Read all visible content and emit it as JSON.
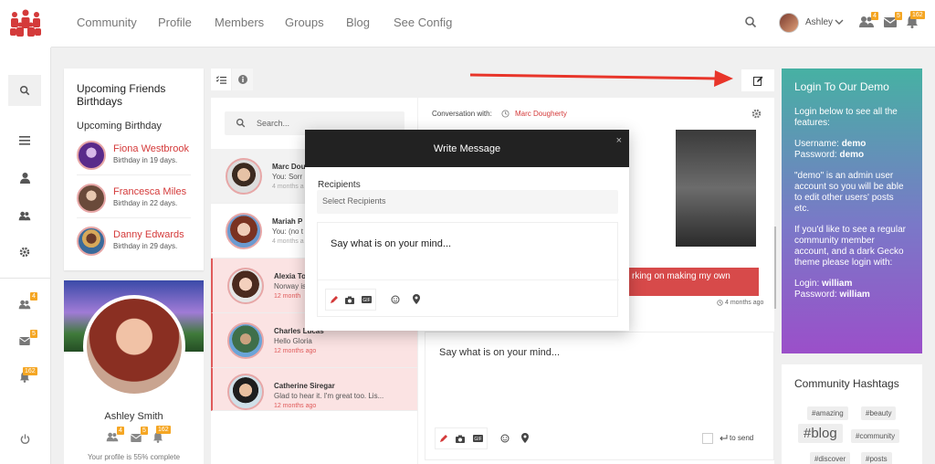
{
  "nav": {
    "links": [
      "Community",
      "Profile",
      "Members",
      "Groups",
      "Blog",
      "See Config"
    ],
    "user_name": "Ashley",
    "badges": {
      "friends": "4",
      "messages": "5",
      "notifications": "162"
    }
  },
  "rail": {
    "badges": {
      "friends": "4",
      "messages": "5",
      "notifications": "162"
    }
  },
  "birthdays": {
    "title": "Upcoming Friends Birthdays",
    "subtitle": "Upcoming Birthday",
    "items": [
      {
        "name": "Fiona Westbrook",
        "sub": "Birthday in 19 days."
      },
      {
        "name": "Francesca Miles",
        "sub": "Birthday in 22 days."
      },
      {
        "name": "Danny Edwards",
        "sub": "Birthday in 29 days."
      }
    ]
  },
  "profile": {
    "name": "Ashley Smith",
    "badges": {
      "friends": "4",
      "messages": "5",
      "notifications": "162"
    },
    "completion": "Your profile is 55% complete"
  },
  "list": {
    "search_placeholder": "Search...",
    "conversations": [
      {
        "name": "Marc Dou",
        "msg": "You: Sorr",
        "time": "4 months a"
      },
      {
        "name": "Mariah P",
        "msg": "You: (no t",
        "time": "4 months a"
      },
      {
        "name": "Alexia To",
        "msg": "Norway is",
        "time": "12 month"
      },
      {
        "name": "Charles Lucas",
        "msg": "Hello Gloria",
        "time": "12 months ago"
      },
      {
        "name": "Catherine Siregar",
        "msg": "Glad to hear it. I'm great too. Lis...",
        "time": "12 months ago"
      }
    ]
  },
  "conversation": {
    "with_label": "Conversation with:",
    "with_name": "Marc Dougherty",
    "bubble_text": "rking on making my own",
    "bubble_time": "4 months ago",
    "compose_placeholder": "Say what is on your mind...",
    "send_label": "to send"
  },
  "modal": {
    "title": "Write Message",
    "close": "×",
    "recipients_label": "Recipients",
    "recipients_placeholder": "Select Recipients",
    "compose_placeholder": "Say what is on your mind..."
  },
  "login": {
    "title": "Login To Our Demo",
    "intro": "Login below to see all the features:",
    "username_label": "Username:",
    "username": "demo",
    "password_label": "Password:",
    "password": "demo",
    "admin_note": "\"demo\" is an admin user account so you will be able to edit other users' posts etc.",
    "regular_note": "If you'd like to see a regular community member account, and a dark Gecko theme please login with:",
    "login_label": "Login:",
    "login": "william",
    "password2_label": "Password:",
    "password2": "william"
  },
  "hashtags": {
    "title": "Community Hashtags",
    "tags": [
      "#amazing",
      "#beauty",
      "#blog",
      "#community",
      "#discover",
      "#posts"
    ]
  },
  "colors": {
    "accent": "#d43a3a",
    "badge": "#f5a623",
    "modal_header": "#222222"
  }
}
